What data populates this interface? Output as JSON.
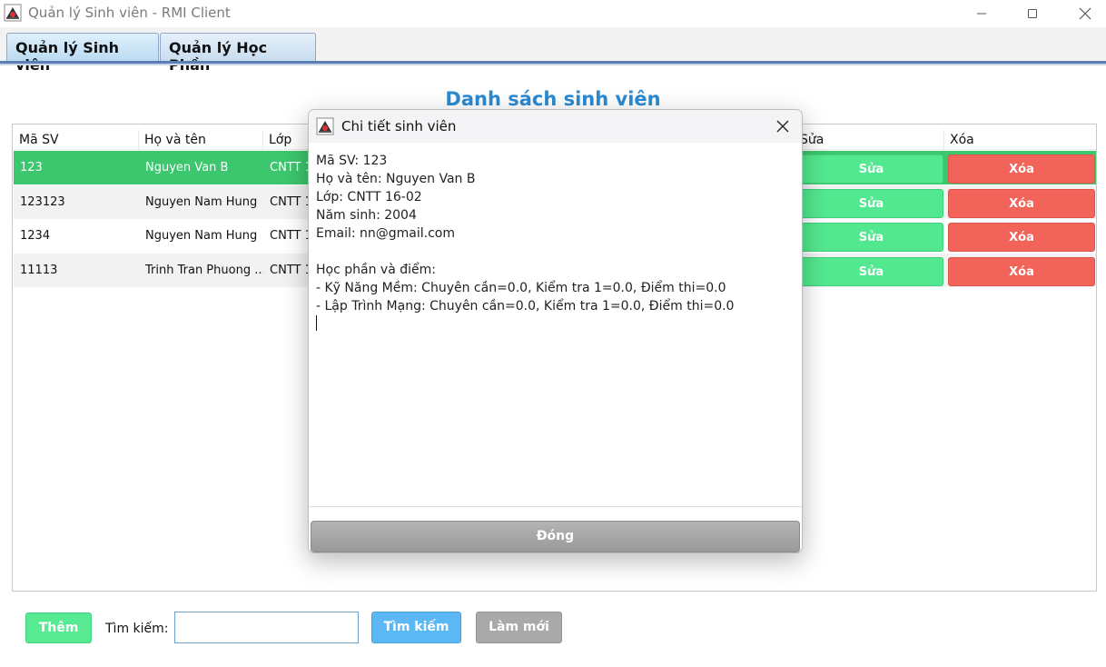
{
  "window": {
    "title": "Quản lý Sinh viên - RMI Client",
    "icon": "java-app-icon"
  },
  "tabs": [
    {
      "label": "Quản lý Sinh viên",
      "active": true
    },
    {
      "label": "Quản lý Học Phần",
      "active": false
    }
  ],
  "heading": "Danh sách sinh viên",
  "table": {
    "columns": [
      "Mã SV",
      "Họ và tên",
      "Lớp",
      "Sửa",
      "Xóa"
    ],
    "rows": [
      {
        "id": "123",
        "name": "Nguyen Van B",
        "class": "CNTT 1",
        "edit": "Sửa",
        "delete": "Xóa",
        "selected": true
      },
      {
        "id": "123123",
        "name": "Nguyen Nam Hung",
        "class": "CNTT 1",
        "edit": "Sửa",
        "delete": "Xóa",
        "selected": false
      },
      {
        "id": "1234",
        "name": "Nguyen Nam Hung",
        "class": "CNTT 1",
        "edit": "Sửa",
        "delete": "Xóa",
        "selected": false
      },
      {
        "id": "11113",
        "name": "Trinh Tran Phuong ...",
        "class": "CNTT 1",
        "edit": "Sửa",
        "delete": "Xóa",
        "selected": false
      }
    ]
  },
  "bottom": {
    "add_label": "Thêm",
    "search_label": "Tìm kiếm:",
    "search_value": "",
    "search_button": "Tìm kiếm",
    "refresh_button": "Làm mới"
  },
  "dialog": {
    "title": "Chi tiết sinh viên",
    "lines": [
      "Mã SV: 123",
      "Họ và tên: Nguyen Van B",
      "Lớp: CNTT 16-02",
      "Năm sinh: 2004",
      "Email: nn@gmail.com",
      "",
      "Học phần và điểm:",
      "- Kỹ Năng Mềm: Chuyên cần=0.0, Kiểm tra 1=0.0, Điểm thi=0.0",
      "- Lập Trình Mạng: Chuyên cần=0.0, Kiểm tra 1=0.0, Điểm thi=0.0"
    ],
    "close_button": "Đóng"
  },
  "colors": {
    "heading": "#2b8ad1",
    "selected_row": "#3cc66d",
    "edit_button": "#52e88f",
    "delete_button": "#f2645a",
    "search_button": "#5bb8f5",
    "refresh_button": "#a9a9a9"
  }
}
